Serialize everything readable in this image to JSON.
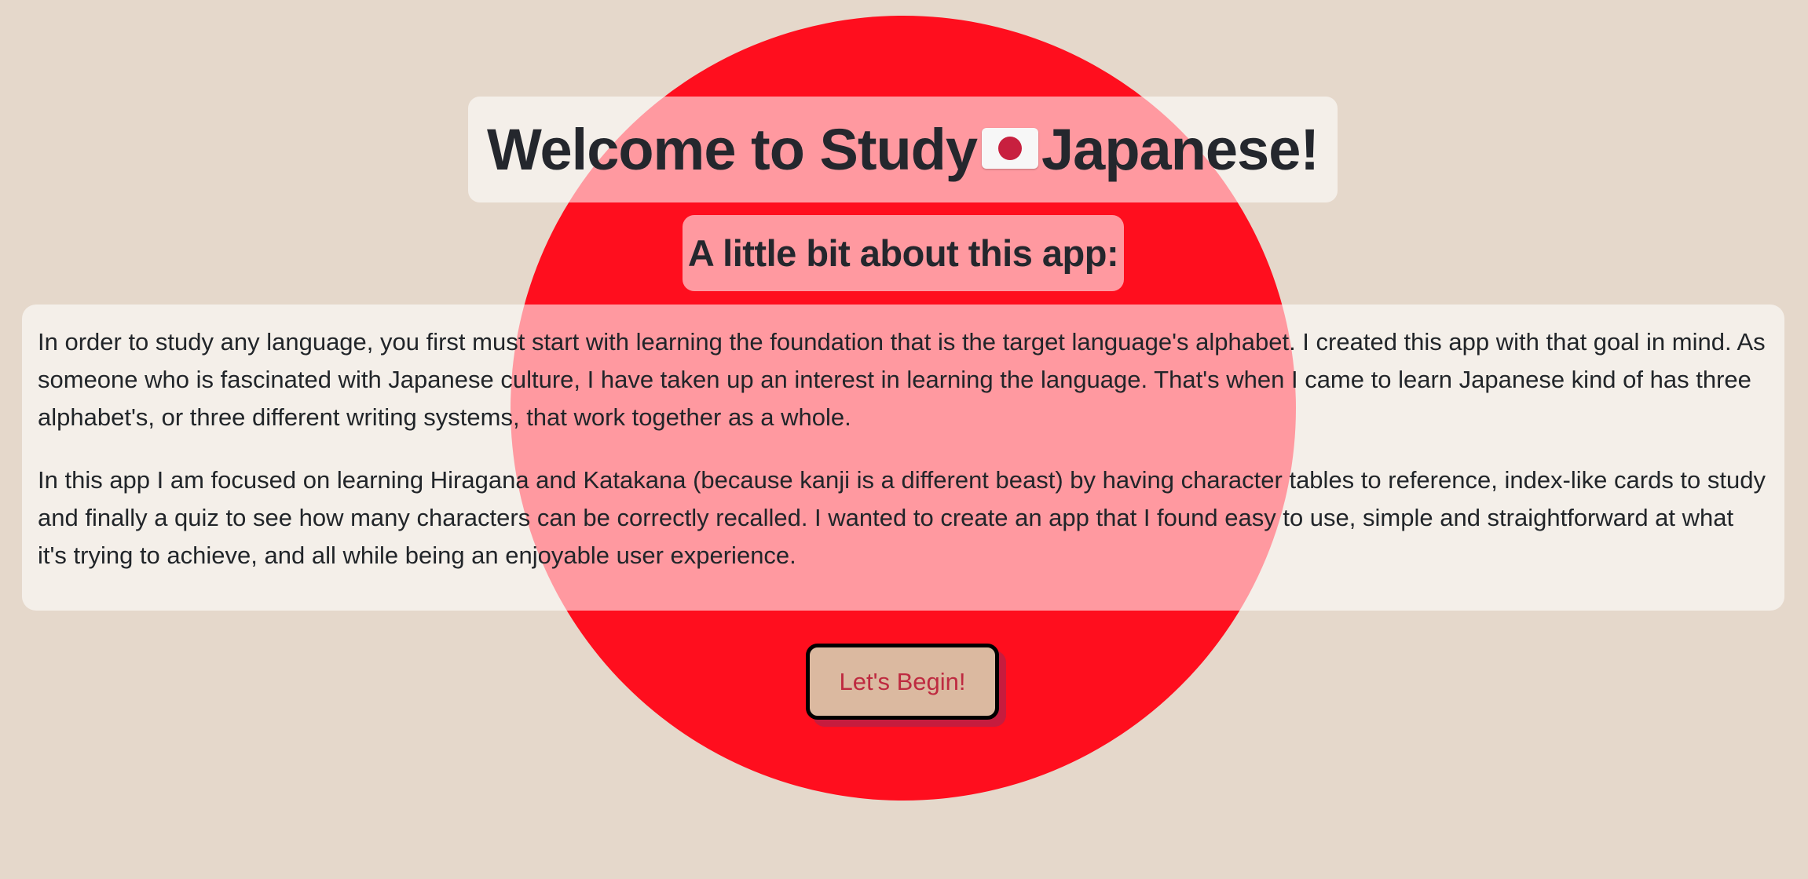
{
  "colors": {
    "background": "#e5d8cb",
    "sun": "#ff0e1e",
    "card": "#f3ede7",
    "button_bg": "#dbb9a0",
    "button_text": "#be2a40",
    "button_shadow": "#c61c3e"
  },
  "header": {
    "title_before": "Welcome to Study",
    "flag_icon": "japan-flag-icon",
    "title_after": "Japanese!"
  },
  "about": {
    "heading": "A little bit about this app:",
    "paragraphs": [
      "In order to study any language, you first must start with learning the foundation that is the target language's alphabet. I created this app with that goal in mind. As someone who is fascinated with Japanese culture, I have taken up an interest in learning the language. That's when I came to learn Japanese kind of has three alphabet's, or three different writing systems, that work together as a whole.",
      "In this app I am focused on learning Hiragana and Katakana (because kanji is a different beast) by having character tables to reference, index-like cards to study and finally a quiz to see how many characters can be correctly recalled. I wanted to create an app that I found easy to use, simple and straightforward at what it's trying to achieve, and all while being an enjoyable user experience."
    ]
  },
  "actions": {
    "begin_label": "Let's Begin!"
  }
}
